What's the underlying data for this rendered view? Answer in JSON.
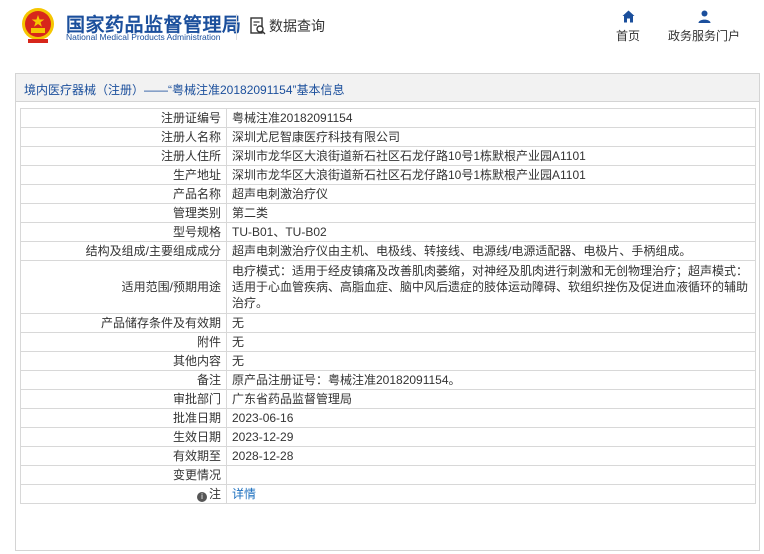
{
  "header": {
    "brand_cn": "国家药品监督管理局",
    "brand_en": "National Medical Products Administration",
    "query_label": "数据查询",
    "nav": [
      {
        "label": "首页",
        "icon": "home-icon"
      },
      {
        "label": "政务服务门户",
        "icon": "user-icon"
      }
    ]
  },
  "panel": {
    "title": "境内医疗器械（注册）——“粤械注准20182091154”基本信息"
  },
  "rows": [
    {
      "key": "注册证编号",
      "value": "粤械注准20182091154"
    },
    {
      "key": "注册人名称",
      "value": "深圳尤尼智康医疗科技有限公司"
    },
    {
      "key": "注册人住所",
      "value": "深圳市龙华区大浪街道新石社区石龙仔路10号1栋默根产业园A1101"
    },
    {
      "key": "生产地址",
      "value": "深圳市龙华区大浪街道新石社区石龙仔路10号1栋默根产业园A1101"
    },
    {
      "key": "产品名称",
      "value": "超声电刺激治疗仪"
    },
    {
      "key": "管理类别",
      "value": "第二类"
    },
    {
      "key": "型号规格",
      "value": "TU-B01、TU-B02"
    },
    {
      "key": "结构及组成/主要组成成分",
      "value": "超声电刺激治疗仪由主机、电极线、转接线、电源线/电源适配器、电极片、手柄组成。"
    },
    {
      "key": "适用范围/预期用途",
      "value": "电疗模式：适用于经皮镇痛及改善肌肉萎缩，对神经及肌肉进行刺激和无创物理治疗；超声模式：适用于心血管疾病、高脂血症、脑中风后遗症的肢体运动障碍、软组织挫伤及促进血液循环的辅助治疗。"
    },
    {
      "key": "产品储存条件及有效期",
      "value": "无"
    },
    {
      "key": "附件",
      "value": "无"
    },
    {
      "key": "其他内容",
      "value": "无"
    },
    {
      "key": "备注",
      "value": "原产品注册证号：粤械注准20182091154。"
    },
    {
      "key": "审批部门",
      "value": "广东省药品监督管理局"
    },
    {
      "key": "批准日期",
      "value": "2023-06-16"
    },
    {
      "key": "生效日期",
      "value": "2023-12-29"
    },
    {
      "key": "有效期至",
      "value": "2028-12-28"
    },
    {
      "key": "变更情况",
      "value": ""
    },
    {
      "key": "注",
      "value": "详情"
    }
  ],
  "colors": {
    "brand": "#1b4f9c",
    "link": "#1b6fbf",
    "emblem_red": "#d7261b",
    "emblem_gold": "#f5c600"
  }
}
